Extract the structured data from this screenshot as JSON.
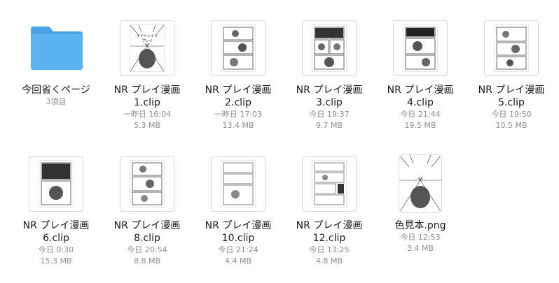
{
  "items": [
    {
      "name": "今回省くページ",
      "date": "3項目",
      "size": "",
      "type": "folder"
    },
    {
      "name": "NR プレイ漫画\n1.clip",
      "date": "一昨日 16:04",
      "size": "5.3 MB",
      "type": "clip"
    },
    {
      "name": "NR プレイ漫画\n2.clip",
      "date": "一昨日 17:03",
      "size": "13.4 MB",
      "type": "clip"
    },
    {
      "name": "NR プレイ漫画\n3.clip",
      "date": "今日 19:37",
      "size": "9.7 MB",
      "type": "clip"
    },
    {
      "name": "NR プレイ漫画\n4.clip",
      "date": "今日 21:44",
      "size": "19.5 MB",
      "type": "clip"
    },
    {
      "name": "NR プレイ漫画\n5.clip",
      "date": "今日 19:50",
      "size": "10.5 MB",
      "type": "clip"
    },
    {
      "name": "NR プレイ漫画\n6.clip",
      "date": "今日 0:30",
      "size": "15.3 MB",
      "type": "clip"
    },
    {
      "name": "NR プレイ漫画\n8.clip",
      "date": "今日 20:54",
      "size": "8.8 MB",
      "type": "clip"
    },
    {
      "name": "NR プレイ漫画\n10.clip",
      "date": "今日 21:24",
      "size": "4.4 MB",
      "type": "clip"
    },
    {
      "name": "NR プレイ漫画\n12.clip",
      "date": "今日 13:25",
      "size": "4.8 MB",
      "type": "clip"
    },
    {
      "name": "色見本.png",
      "date": "今日 12:53",
      "size": "3.4 MB",
      "type": "png"
    }
  ],
  "colors": {
    "folder": "#5ab3f0",
    "folder_tab": "#4aa3e6",
    "meta_text": "#8e8e93"
  }
}
